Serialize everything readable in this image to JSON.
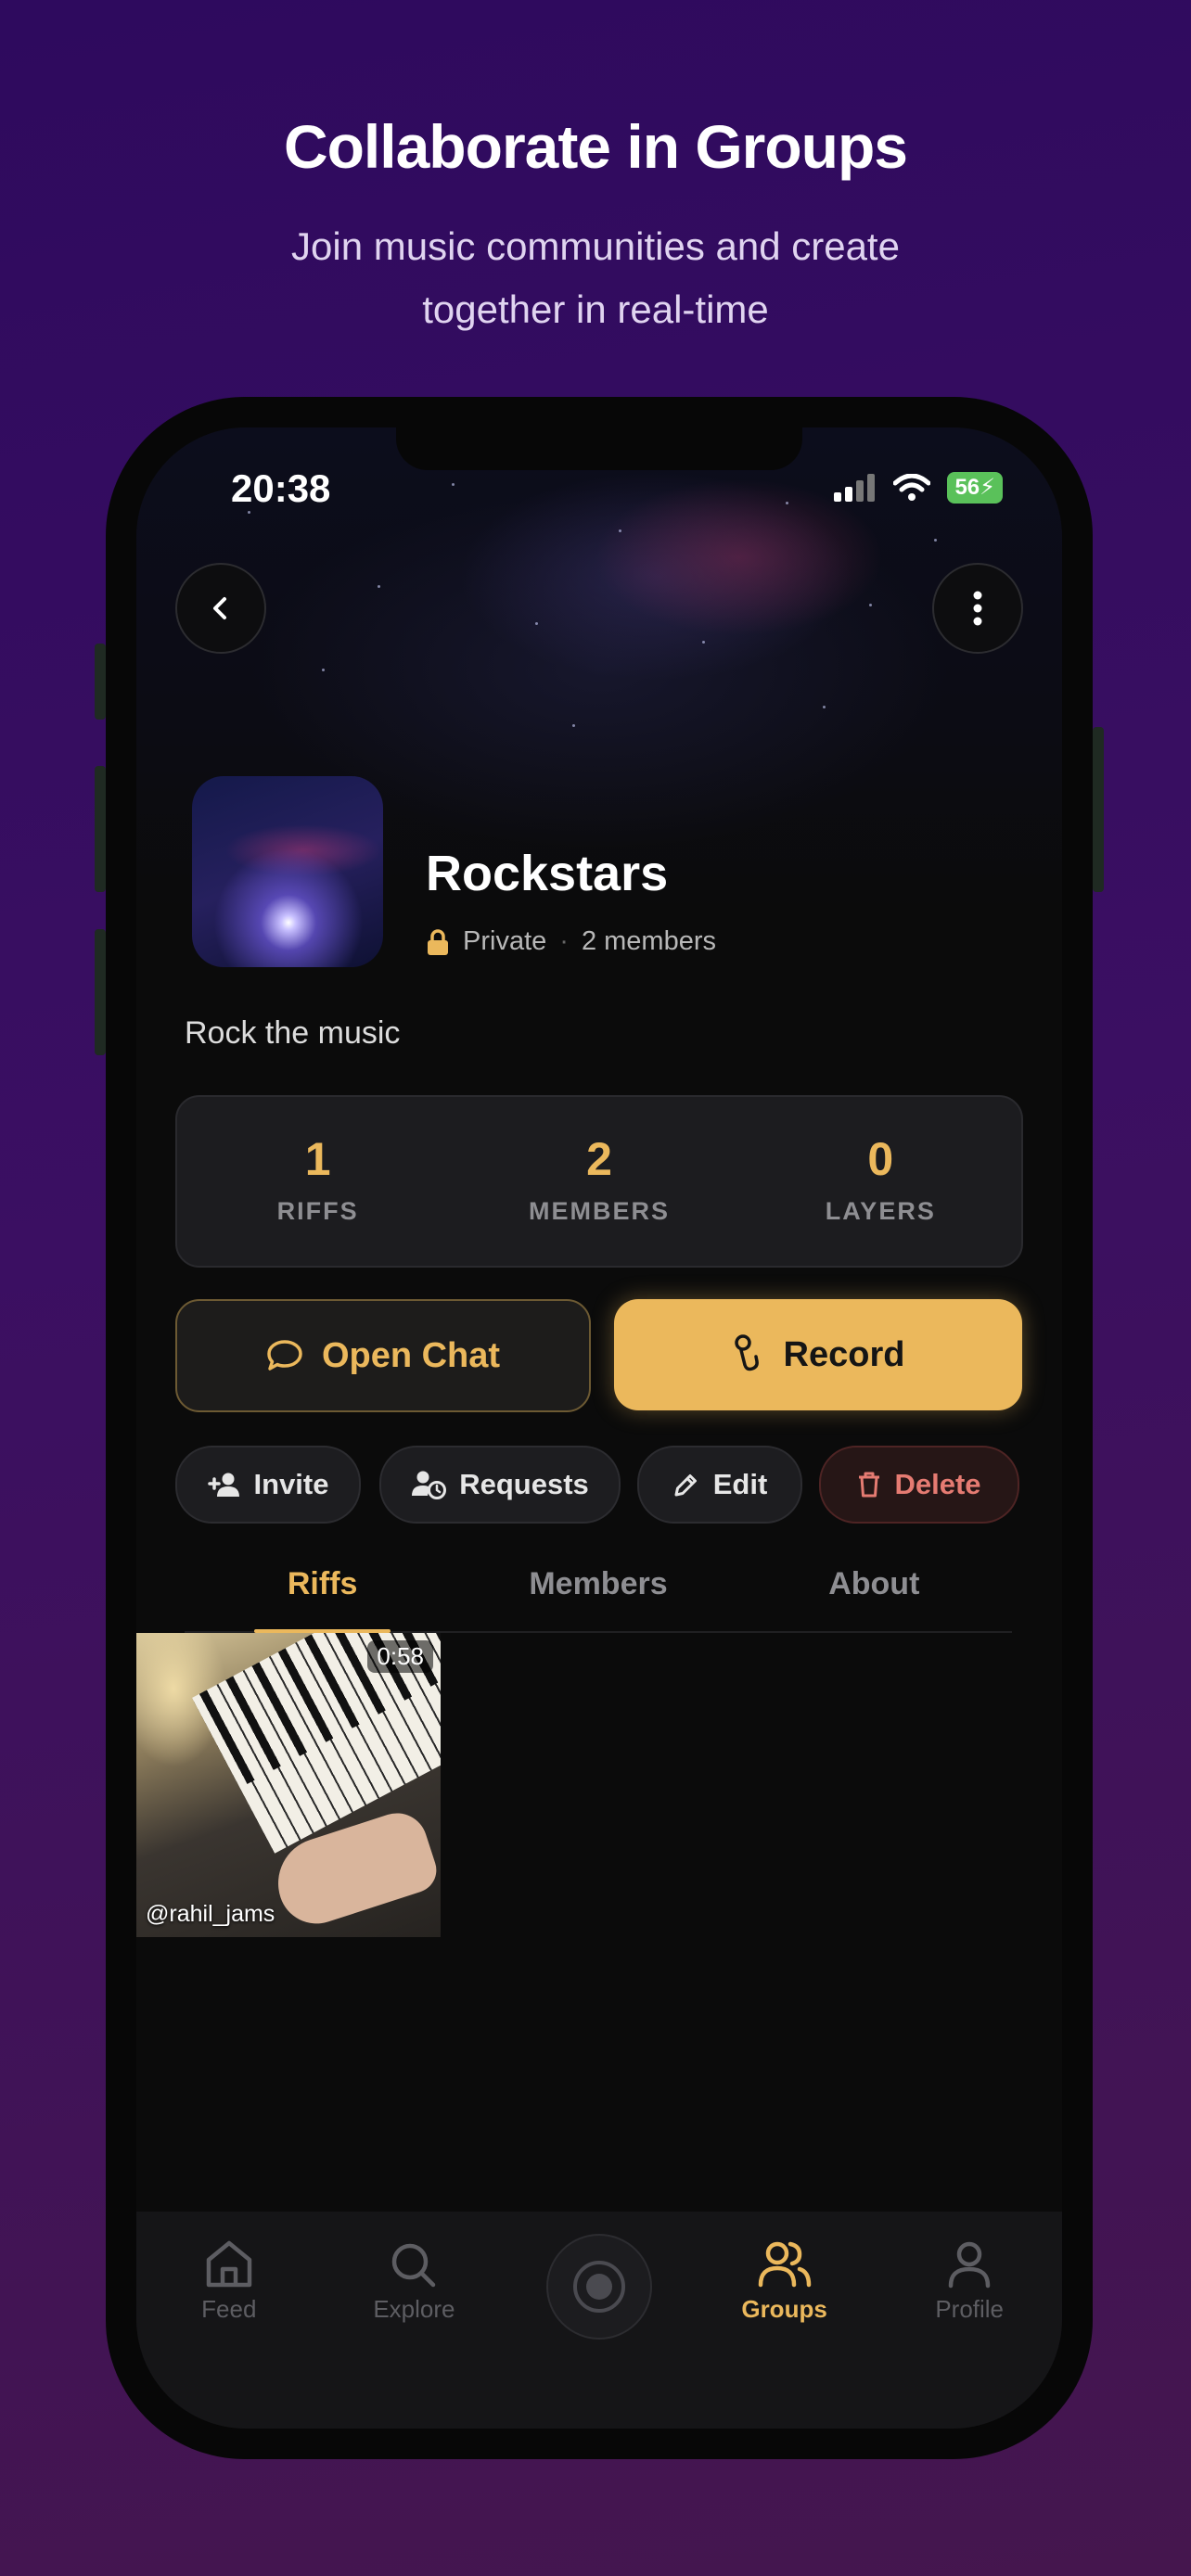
{
  "promo": {
    "title": "Collaborate in Groups",
    "subtitle_line1": "Join music communities and create",
    "subtitle_line2": "together in real-time"
  },
  "status_bar": {
    "time": "20:38",
    "battery": "56"
  },
  "header": {
    "back_icon": "chevron-left-icon",
    "more_icon": "more-vertical-icon"
  },
  "group": {
    "name": "Rockstars",
    "privacy": "Private",
    "separator": "·",
    "members_text": "2 members",
    "description": "Rock the music"
  },
  "stats": [
    {
      "value": "1",
      "label": "RIFFS"
    },
    {
      "value": "2",
      "label": "MEMBERS"
    },
    {
      "value": "0",
      "label": "LAYERS"
    }
  ],
  "actions": {
    "open_chat": "Open Chat",
    "record": "Record",
    "invite": "Invite",
    "requests": "Requests",
    "edit": "Edit",
    "delete": "Delete"
  },
  "tabs": [
    "Riffs",
    "Members",
    "About"
  ],
  "riffs": [
    {
      "duration": "0:58",
      "user": "@rahil_jams"
    }
  ],
  "bottom_nav": [
    {
      "label": "Feed",
      "icon": "home-icon"
    },
    {
      "label": "Explore",
      "icon": "search-icon"
    },
    {
      "label": "Groups",
      "icon": "users-icon"
    },
    {
      "label": "Profile",
      "icon": "user-icon"
    }
  ],
  "colors": {
    "accent": "#ebb85c",
    "danger": "#e57b72",
    "background": "#0b0b0b"
  }
}
